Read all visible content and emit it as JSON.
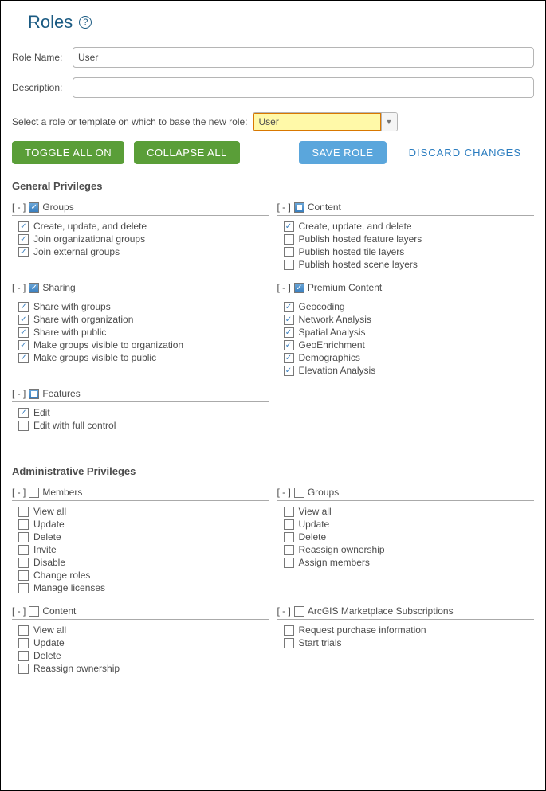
{
  "title": "Roles",
  "form": {
    "roleNameLabel": "Role Name:",
    "roleNameValue": "User",
    "descriptionLabel": "Description:",
    "descriptionValue": "",
    "templateLabel": "Select a role or template on which to base the new role:",
    "templateValue": "User"
  },
  "buttons": {
    "toggleAll": "TOGGLE ALL ON",
    "collapseAll": "COLLAPSE ALL",
    "saveRole": "SAVE ROLE",
    "discard": "DISCARD CHANGES"
  },
  "sections": {
    "general": {
      "title": "General Privileges",
      "groups": [
        {
          "name": "Groups",
          "state": "checked",
          "col": 0,
          "items": [
            {
              "label": "Create, update, and delete",
              "checked": true
            },
            {
              "label": "Join organizational groups",
              "checked": true
            },
            {
              "label": "Join external groups",
              "checked": true
            }
          ]
        },
        {
          "name": "Content",
          "state": "partial",
          "col": 1,
          "items": [
            {
              "label": "Create, update, and delete",
              "checked": true
            },
            {
              "label": "Publish hosted feature layers",
              "checked": false
            },
            {
              "label": "Publish hosted tile layers",
              "checked": false
            },
            {
              "label": "Publish hosted scene layers",
              "checked": false
            }
          ]
        },
        {
          "name": "Sharing",
          "state": "checked",
          "col": 0,
          "items": [
            {
              "label": "Share with groups",
              "checked": true
            },
            {
              "label": "Share with organization",
              "checked": true
            },
            {
              "label": "Share with public",
              "checked": true
            },
            {
              "label": "Make groups visible to organization",
              "checked": true
            },
            {
              "label": "Make groups visible to public",
              "checked": true
            }
          ]
        },
        {
          "name": "Premium Content",
          "state": "checked",
          "col": 1,
          "items": [
            {
              "label": "Geocoding",
              "checked": true
            },
            {
              "label": "Network Analysis",
              "checked": true
            },
            {
              "label": "Spatial Analysis",
              "checked": true
            },
            {
              "label": "GeoEnrichment",
              "checked": true
            },
            {
              "label": "Demographics",
              "checked": true
            },
            {
              "label": "Elevation Analysis",
              "checked": true
            }
          ]
        },
        {
          "name": "Features",
          "state": "partial",
          "col": 0,
          "items": [
            {
              "label": "Edit",
              "checked": true
            },
            {
              "label": "Edit with full control",
              "checked": false
            }
          ]
        }
      ]
    },
    "admin": {
      "title": "Administrative Privileges",
      "groups": [
        {
          "name": "Members",
          "state": "unchecked",
          "col": 0,
          "items": [
            {
              "label": "View all",
              "checked": false
            },
            {
              "label": "Update",
              "checked": false
            },
            {
              "label": "Delete",
              "checked": false
            },
            {
              "label": "Invite",
              "checked": false
            },
            {
              "label": "Disable",
              "checked": false
            },
            {
              "label": "Change roles",
              "checked": false
            },
            {
              "label": "Manage licenses",
              "checked": false
            }
          ]
        },
        {
          "name": "Groups",
          "state": "unchecked",
          "col": 1,
          "items": [
            {
              "label": "View all",
              "checked": false
            },
            {
              "label": "Update",
              "checked": false
            },
            {
              "label": "Delete",
              "checked": false
            },
            {
              "label": "Reassign ownership",
              "checked": false
            },
            {
              "label": "Assign members",
              "checked": false
            }
          ]
        },
        {
          "name": "Content",
          "state": "unchecked",
          "col": 0,
          "items": [
            {
              "label": "View all",
              "checked": false
            },
            {
              "label": "Update",
              "checked": false
            },
            {
              "label": "Delete",
              "checked": false
            },
            {
              "label": "Reassign ownership",
              "checked": false
            }
          ]
        },
        {
          "name": "ArcGIS Marketplace Subscriptions",
          "state": "unchecked",
          "col": 1,
          "items": [
            {
              "label": "Request purchase information",
              "checked": false
            },
            {
              "label": "Start trials",
              "checked": false
            }
          ]
        }
      ]
    }
  }
}
